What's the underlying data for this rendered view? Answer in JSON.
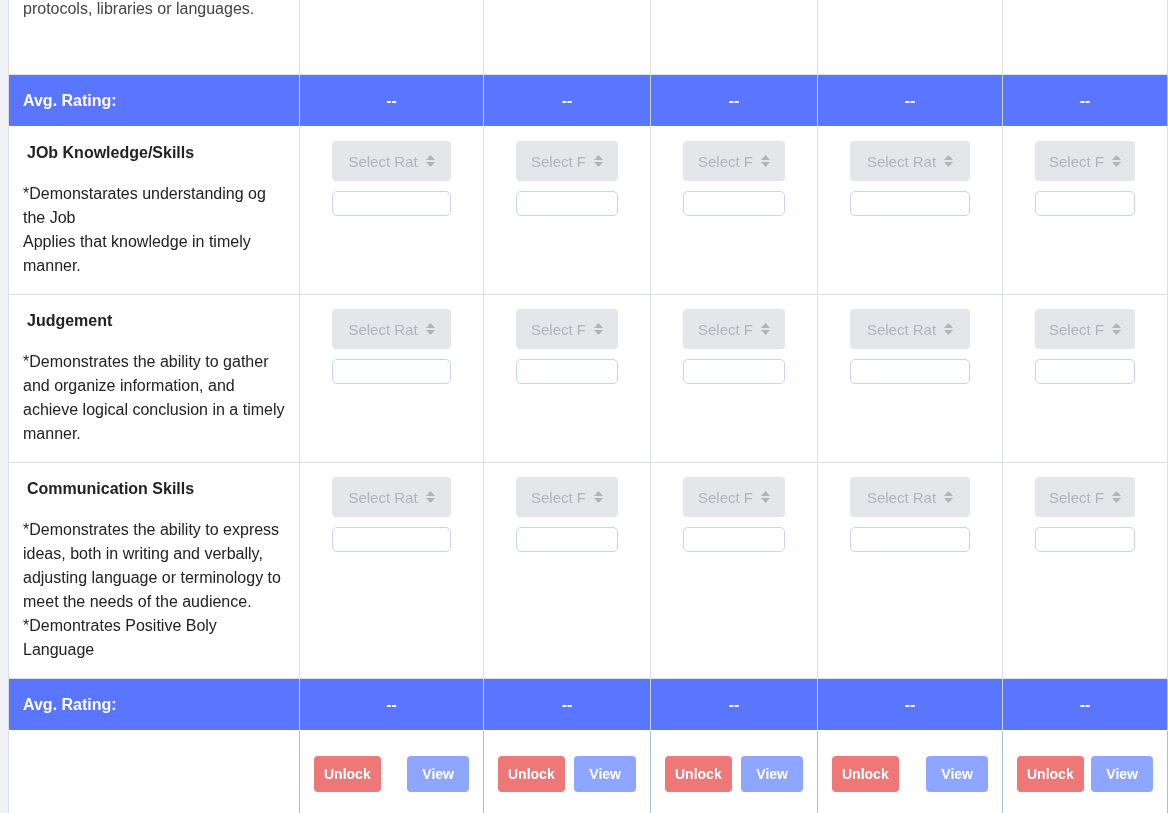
{
  "rows": [
    {
      "kind": "note",
      "text": "protocols, libraries or languages."
    },
    {
      "kind": "average",
      "label": "Avg. Rating:",
      "values": [
        "--",
        "--",
        "--",
        "--",
        "--"
      ]
    },
    {
      "kind": "criterion",
      "title": "JOb Knowledge/Skills",
      "description": [
        "*Demonstarates understanding og the Job",
        "Applies that knowledge in timely manner."
      ],
      "selects": [
        {
          "value": "Select Rat",
          "disabled": true
        },
        {
          "value": "Select F",
          "disabled": true
        },
        {
          "value": "Select F",
          "disabled": true
        },
        {
          "value": "Select Rat",
          "disabled": true
        },
        {
          "value": "Select F",
          "disabled": true
        }
      ]
    },
    {
      "kind": "criterion",
      "title": "Judgement",
      "description": [
        "*Demonstrates the ability to gather and organize information, and achieve logical conclusion in a timely manner."
      ],
      "selects": [
        {
          "value": "Select Rat",
          "disabled": true
        },
        {
          "value": "Select F",
          "disabled": true
        },
        {
          "value": "Select F",
          "disabled": true
        },
        {
          "value": "Select Rat",
          "disabled": true
        },
        {
          "value": "Select F",
          "disabled": true
        }
      ]
    },
    {
      "kind": "criterion",
      "title": "Communication Skills",
      "description": [
        "*Demonstrates the ability to express ideas, both in writing and verbally, adjusting language or terminology to meet the needs of the audience.",
        "*Demontrates Positive Boly Language"
      ],
      "selects": [
        {
          "value": "Select Rat",
          "disabled": true
        },
        {
          "value": "Select F",
          "disabled": true
        },
        {
          "value": "Select F",
          "disabled": true
        },
        {
          "value": "Select Rat",
          "disabled": true
        },
        {
          "value": "Select F",
          "disabled": true
        }
      ]
    },
    {
      "kind": "average",
      "label": "Avg. Rating:",
      "values": [
        "--",
        "--",
        "--",
        "--",
        "--"
      ]
    },
    {
      "kind": "actions",
      "columns": [
        [
          {
            "kind": "unlock",
            "label": "Unlock"
          },
          {
            "kind": "view",
            "label": "View"
          }
        ],
        [
          {
            "kind": "unlock",
            "label": "Unlock"
          },
          {
            "kind": "view",
            "label": "View"
          }
        ],
        [
          {
            "kind": "unlock",
            "label": "Unlock"
          },
          {
            "kind": "view",
            "label": "View"
          }
        ],
        [
          {
            "kind": "unlock",
            "label": "Unlock"
          },
          {
            "kind": "view",
            "label": "View"
          }
        ],
        [
          {
            "kind": "unlock",
            "label": "Unlock"
          },
          {
            "kind": "view",
            "label": "View"
          }
        ]
      ]
    }
  ]
}
